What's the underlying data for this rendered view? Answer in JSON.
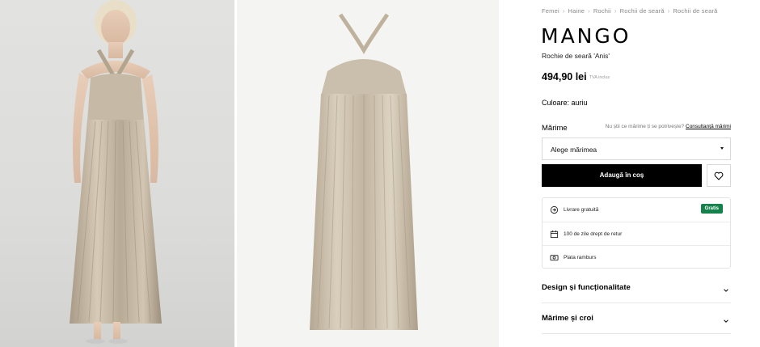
{
  "breadcrumb": [
    "Femei",
    "Haine",
    "Rochii",
    "Rochii de seară",
    "Rochii de seară"
  ],
  "brand": {
    "logo_text": "MANGO"
  },
  "product": {
    "name": "Rochie de seară 'Anis'",
    "price": "494,90 lei",
    "vat_note": "TVA inclus",
    "color_label": "Culoare:",
    "color_value": "auriu"
  },
  "size": {
    "label": "Mărime",
    "help_text": "Nu știi ce mărime ți se potrivește?",
    "help_link": "Consultanță mărimi",
    "select_value": "Alege mărimea"
  },
  "actions": {
    "add_to_cart": "Adaugă în coș",
    "favorite_icon": "heart-icon"
  },
  "benefits": [
    {
      "icon": "delivery-icon",
      "label": "Livrare gratuită",
      "badge": "Gratis"
    },
    {
      "icon": "calendar-icon",
      "label": "100 de zile drept de retur"
    },
    {
      "icon": "cash-icon",
      "label": "Plata ramburs"
    }
  ],
  "accordions": [
    {
      "label": "Design și funcționalitate"
    },
    {
      "label": "Mărime și croi"
    }
  ],
  "colors": {
    "accent": "#000000",
    "badge": "#16824b",
    "dress": "#bdb19e"
  }
}
